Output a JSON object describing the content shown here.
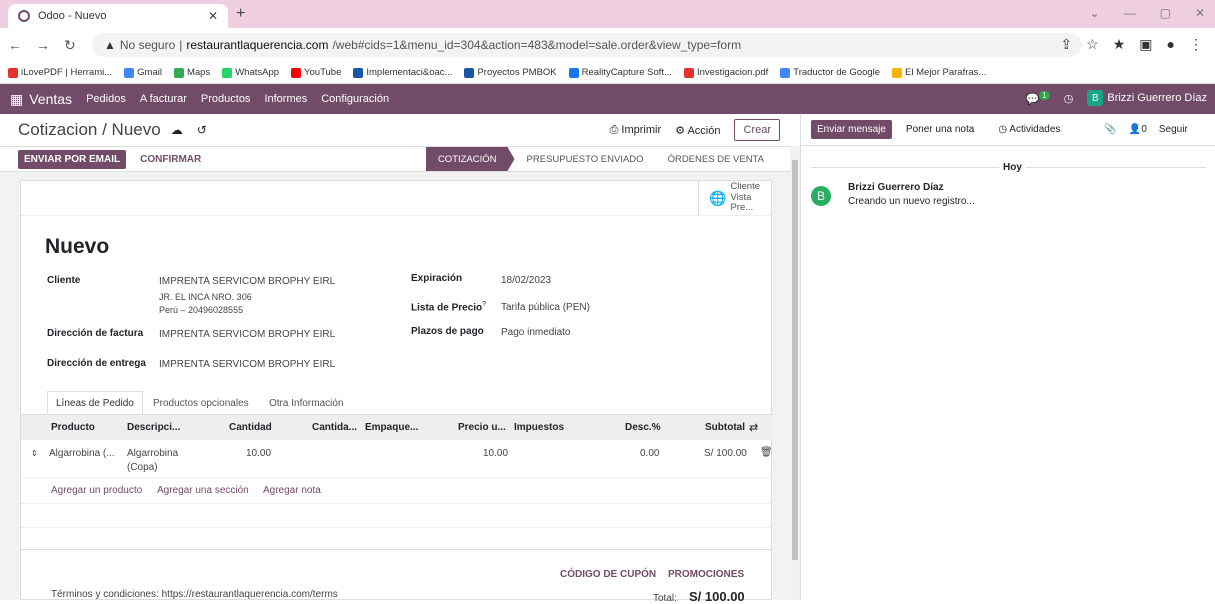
{
  "browser": {
    "tab_title": "Odoo - Nuevo",
    "insecure_label": "No seguro",
    "url_host": "restaurantlaquerencia.com",
    "url_path": "/web#cids=1&menu_id=304&action=483&model=sale.order&view_type=form"
  },
  "bookmarks": [
    {
      "label": "iLovePDF | Herrami...",
      "color": "#e5322d"
    },
    {
      "label": "Gmail",
      "color": "#4285f4"
    },
    {
      "label": "Maps",
      "color": "#34a853"
    },
    {
      "label": "WhatsApp",
      "color": "#25d366"
    },
    {
      "label": "YouTube",
      "color": "#ff0000"
    },
    {
      "label": "Implementaci&oac...",
      "color": "#1a56a6"
    },
    {
      "label": "Proyectos PMBOK",
      "color": "#1a56a6"
    },
    {
      "label": "RealityCapture Soft...",
      "color": "#1877f2"
    },
    {
      "label": "Investigacion.pdf",
      "color": "#e5322d"
    },
    {
      "label": "Traductor de Google",
      "color": "#4285f4"
    },
    {
      "label": "El Mejor Parafras...",
      "color": "#f4b400"
    }
  ],
  "nav": {
    "app": "Ventas",
    "menu": [
      "Pedidos",
      "A facturar",
      "Productos",
      "Informes",
      "Configuración"
    ],
    "msg_count": "1",
    "user": "Brizzi Guerrero Díaz",
    "user_initial": "B"
  },
  "cp": {
    "breadcrumb": "Cotizacion / Nuevo",
    "print": "Imprimir",
    "action": "Acción",
    "create": "Crear"
  },
  "status": {
    "send_email": "ENVIAR POR EMAIL",
    "confirm": "CONFIRMAR",
    "stages": [
      "COTIZACIÓN",
      "PRESUPUESTO ENVIADO",
      "ÓRDENES DE VENTA"
    ]
  },
  "sheet": {
    "customer_btn": {
      "l1": "Cliente",
      "l2": "Vista Pre..."
    },
    "title": "Nuevo",
    "labels": {
      "customer": "Cliente",
      "invoice_addr": "Dirección de factura",
      "delivery_addr": "Dirección de entrega",
      "expiration": "Expiración",
      "pricelist": "Lista de Precio",
      "pricelist_sup": "?",
      "payment_terms": "Plazos de pago"
    },
    "values": {
      "customer": "IMPRENTA SERVICOM BROPHY EIRL",
      "customer_addr1": "JR. EL INCA NRO. 306",
      "customer_addr2": "Perú – 20496028555",
      "invoice_addr": "IMPRENTA SERVICOM BROPHY EIRL",
      "delivery_addr": "IMPRENTA SERVICOM BROPHY EIRL",
      "expiration": "18/02/2023",
      "pricelist": "Tarifa pública (PEN)",
      "payment_terms": "Pago inmediato"
    },
    "tabs": [
      "Líneas de Pedido",
      "Productos opcionales",
      "Otra Información"
    ],
    "columns": [
      "Producto",
      "Descripci...",
      "Cantidad",
      "Cantida...",
      "Empaque...",
      "Precio u...",
      "Impuestos",
      "Desc.%",
      "Subtotal"
    ],
    "row": {
      "product": "Algarrobina (...",
      "desc1": "Algarrobina",
      "desc2": "(Copa)",
      "qty": "10.00",
      "price": "10.00",
      "disc": "0.00",
      "subtotal": "S/ 100.00"
    },
    "add_links": [
      "Agregar un producto",
      "Agregar una sección",
      "Agregar nota"
    ],
    "coupon": "CÓDIGO DE CUPÓN",
    "promotions": "PROMOCIONES",
    "terms": "Términos y condiciones: https://restaurantlaquerencia.com/terms",
    "total_label": "Total:",
    "total_value": "S/ 100.00"
  },
  "chatter": {
    "send_msg": "Enviar mensaje",
    "log_note": "Poner una nota",
    "activities": "Actividades",
    "followers": "0",
    "follow": "Seguir",
    "day": "Hoy",
    "author": "Brizzi Guerrero Díaz",
    "message": "Creando un nuevo registro...",
    "initial": "B"
  },
  "colors": {
    "brand": "#714b67",
    "tabbar": "#f0cfe0"
  }
}
